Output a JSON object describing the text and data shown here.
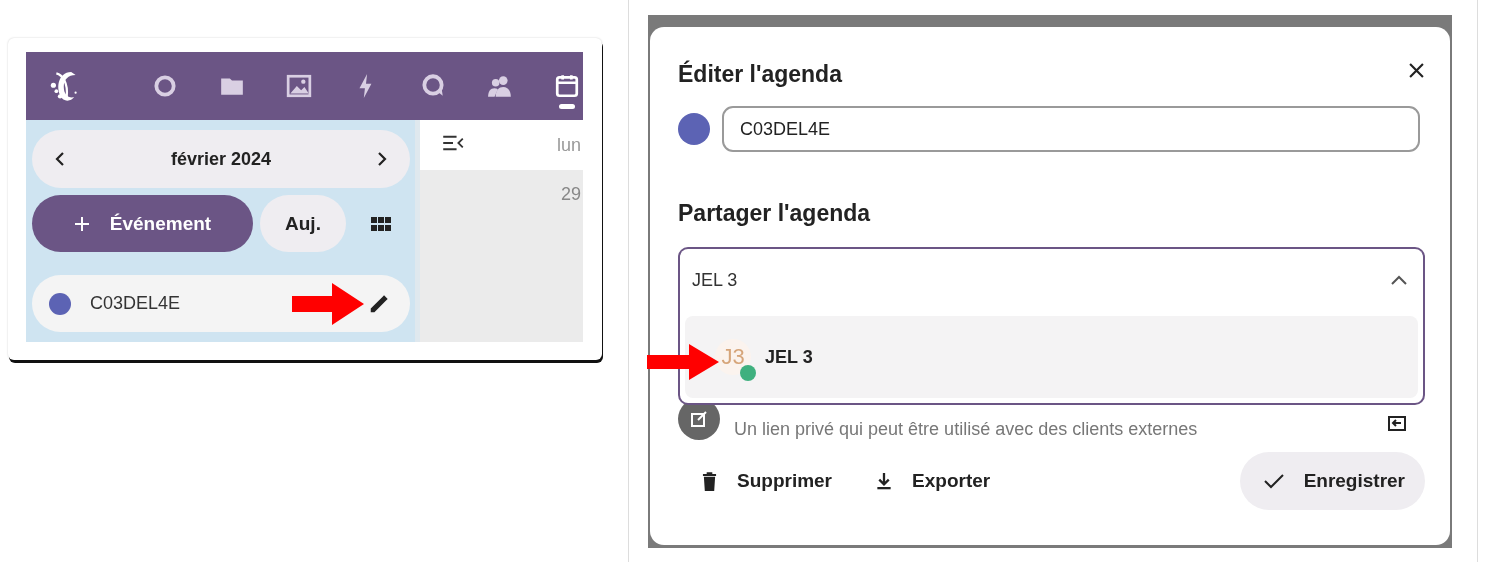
{
  "app": {
    "nav_items": [
      {
        "kind": "circle",
        "selected": false
      },
      {
        "kind": "folder",
        "selected": false
      },
      {
        "kind": "image",
        "selected": false
      },
      {
        "kind": "bolt",
        "selected": false
      },
      {
        "kind": "chat",
        "selected": false
      },
      {
        "kind": "people",
        "selected": false
      },
      {
        "kind": "calendar",
        "selected": true
      }
    ],
    "sidebar": {
      "month": "février 2024",
      "new_event_button": "Événement",
      "today_button": "Auj.",
      "calendars": [
        {
          "name": "C03DEL4E",
          "color": "#5c63b4"
        }
      ]
    },
    "calendar_view": {
      "day_header": "lun",
      "day_number": "29"
    }
  },
  "dialog": {
    "title": "Éditer l'agenda",
    "name_field": {
      "value": "C03DEL4E",
      "color": "#5c63b4"
    },
    "share_title": "Partager l'agenda",
    "share_combo": {
      "value": "JEL 3",
      "expanded": true,
      "options": [
        {
          "initials": "J3",
          "name": "JEL 3",
          "online": true
        }
      ]
    },
    "private_link_hint": "Un lien privé qui peut être utilisé avec des clients externes",
    "buttons": [
      {
        "kind": "delete",
        "label": "Supprimer"
      },
      {
        "kind": "export",
        "label": "Exporter"
      },
      {
        "kind": "save",
        "label": "Enregistrer"
      }
    ]
  }
}
